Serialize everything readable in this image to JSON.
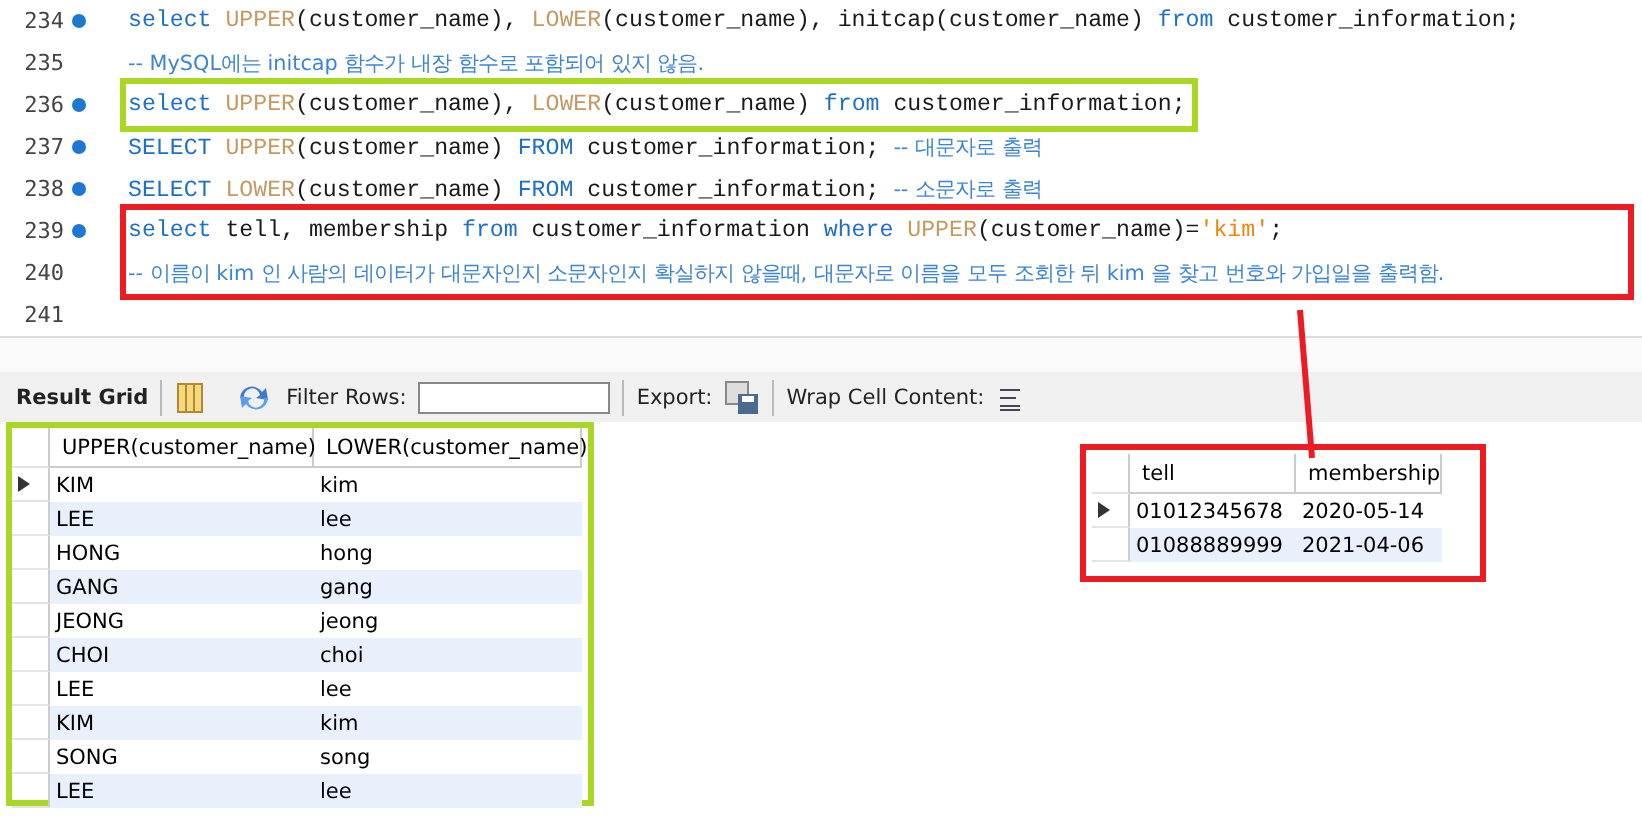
{
  "editor": {
    "blocks": [
      {
        "lines": [
          {
            "number": "234",
            "marker": true,
            "tokens": [
              {
                "t": "select ",
                "kind": "keyword"
              },
              {
                "t": "UPPER",
                "kind": "function"
              },
              {
                "t": "(customer_name), ",
                "kind": "plain"
              },
              {
                "t": "LOWER",
                "kind": "function"
              },
              {
                "t": "(customer_name), initcap(customer_name) ",
                "kind": "plain"
              },
              {
                "t": "from ",
                "kind": "keyword"
              },
              {
                "t": "customer_information;",
                "kind": "plain"
              }
            ]
          },
          {
            "number": "235",
            "marker": false,
            "tokens": [
              {
                "t": "-- MySQL에는 initcap 함수가 내장 함수로 포함되어 있지 않음.",
                "kind": "comment"
              }
            ]
          }
        ]
      },
      {
        "color": "#a8d824",
        "lines": [
          {
            "number": "236",
            "marker": true,
            "tokens": [
              {
                "t": "select ",
                "kind": "keyword"
              },
              {
                "t": "UPPER",
                "kind": "function"
              },
              {
                "t": "(customer_name), ",
                "kind": "plain"
              },
              {
                "t": "LOWER",
                "kind": "function"
              },
              {
                "t": "(customer_name) ",
                "kind": "plain"
              },
              {
                "t": "from ",
                "kind": "keyword"
              },
              {
                "t": "customer_information;",
                "kind": "plain"
              }
            ]
          }
        ]
      },
      {
        "lines": [
          {
            "number": "237",
            "marker": true,
            "tokens": [
              {
                "t": "SELECT ",
                "kind": "keyword"
              },
              {
                "t": "UPPER",
                "kind": "function"
              },
              {
                "t": "(customer_name) ",
                "kind": "plain"
              },
              {
                "t": "FROM ",
                "kind": "keyword"
              },
              {
                "t": "customer_information; ",
                "kind": "plain"
              },
              {
                "t": "-- 대문자로 출력",
                "kind": "comment"
              }
            ]
          },
          {
            "number": "238",
            "marker": true,
            "tokens": [
              {
                "t": "SELECT ",
                "kind": "keyword"
              },
              {
                "t": "LOWER",
                "kind": "function"
              },
              {
                "t": "(customer_name) ",
                "kind": "plain"
              },
              {
                "t": "FROM ",
                "kind": "keyword"
              },
              {
                "t": "customer_information; ",
                "kind": "plain"
              },
              {
                "t": "-- 소문자로 출력",
                "kind": "comment"
              }
            ]
          }
        ]
      },
      {
        "color": "#ec1c24",
        "lines": [
          {
            "number": "239",
            "marker": true,
            "tokens": [
              {
                "t": "select ",
                "kind": "keyword"
              },
              {
                "t": "tell, membership ",
                "kind": "plain"
              },
              {
                "t": "from ",
                "kind": "keyword"
              },
              {
                "t": "customer_information ",
                "kind": "plain"
              },
              {
                "t": "where ",
                "kind": "keyword"
              },
              {
                "t": "UPPER",
                "kind": "function"
              },
              {
                "t": "(customer_name)=",
                "kind": "plain"
              },
              {
                "t": "'kim'",
                "kind": "string"
              },
              {
                "t": ";",
                "kind": "plain"
              }
            ]
          },
          {
            "number": "240",
            "marker": false,
            "tokens": [
              {
                "t": "-- 이름이 kim 인 사람의 데이터가 대문자인지 소문자인지 확실하지 않을때, 대문자로 이름을 모두 조회한 뒤 kim 을 찾고 번호와 가입일을 출력함.",
                "kind": "comment"
              }
            ]
          }
        ]
      },
      {
        "lines": [
          {
            "number": "241",
            "marker": false
          }
        ]
      }
    ]
  },
  "toolbar": {
    "title": "Result Grid",
    "filter_label": "Filter Rows:",
    "export_label": "Export:",
    "wrap_label": "Wrap Cell Content:"
  },
  "grids": [
    {
      "color": "#a8d824",
      "columns": [
        "UPPER(customer_name)",
        "LOWER(customer_name)"
      ],
      "rows": [
        {
          "current": true,
          "cells": [
            "KIM",
            "kim"
          ]
        },
        {
          "current": false,
          "cells": [
            "LEE",
            "lee"
          ]
        },
        {
          "current": false,
          "cells": [
            "HONG",
            "hong"
          ]
        },
        {
          "current": false,
          "cells": [
            "GANG",
            "gang"
          ]
        },
        {
          "current": false,
          "cells": [
            "JEONG",
            "jeong"
          ]
        },
        {
          "current": false,
          "cells": [
            "CHOI",
            "choi"
          ]
        },
        {
          "current": false,
          "cells": [
            "LEE",
            "lee"
          ]
        },
        {
          "current": false,
          "cells": [
            "KIM",
            "kim"
          ]
        },
        {
          "current": false,
          "cells": [
            "SONG",
            "song"
          ]
        },
        {
          "current": false,
          "cells": [
            "LEE",
            "lee"
          ]
        }
      ]
    },
    {
      "color": "#ec1c24",
      "columns": [
        "tell",
        "membership"
      ],
      "rows": [
        {
          "current": true,
          "cells": [
            "01012345678",
            "2020-05-14"
          ]
        },
        {
          "current": false,
          "cells": [
            "01088889999",
            "2021-04-06"
          ]
        }
      ]
    }
  ]
}
